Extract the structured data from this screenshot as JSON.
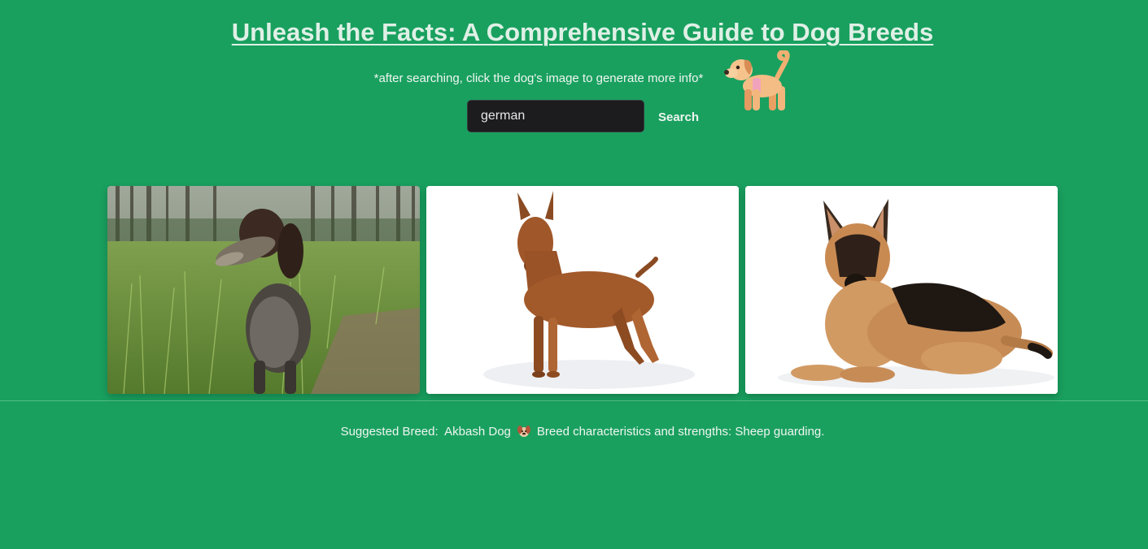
{
  "header": {
    "title": "Unleash the Facts: A Comprehensive Guide to Dog Breeds",
    "hint": "*after searching, click the dog's image to generate more info*",
    "mascot_icon": "dog-emoji"
  },
  "search": {
    "value": "german",
    "button_label": "Search"
  },
  "results": [
    {
      "image": "spaniel-retrieving-bird-in-forest",
      "alt": ""
    },
    {
      "image": "brown-pinscher-standing-on-white",
      "alt": ""
    },
    {
      "image": "german-shepherd-lying-on-white",
      "alt": ""
    }
  ],
  "suggestion": {
    "label": "Suggested Breed:",
    "breed": "Akbash Dog",
    "face_icon": "dog-face-emoji",
    "details": "Breed characteristics and strengths: Sheep guarding."
  },
  "colors": {
    "background": "#19a05f",
    "title": "#dff0e6",
    "input_background": "#1c1c1f"
  }
}
